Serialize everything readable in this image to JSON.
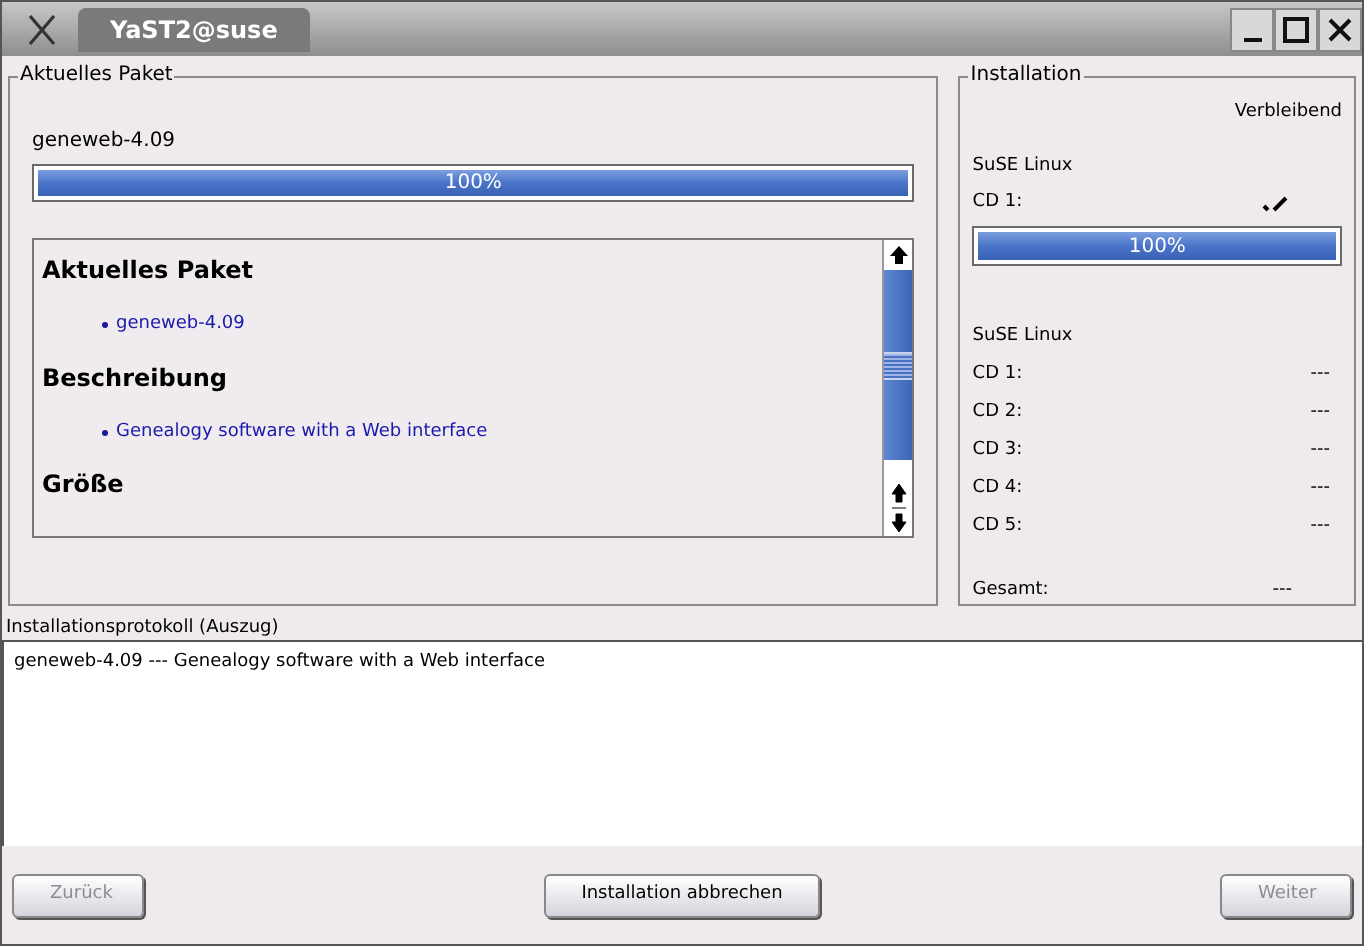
{
  "window": {
    "title": "YaST2@suse"
  },
  "current_package": {
    "title": "Aktuelles Paket",
    "name": "geneweb-4.09",
    "progress": {
      "level": 1,
      "reading": "100%"
    },
    "details": [
      {
        "heading": "Aktuelles Paket",
        "items": [
          "geneweb-4.09"
        ]
      },
      {
        "heading": "Beschreibung",
        "items": [
          "Genealogy software with a Web interface"
        ]
      },
      {
        "heading": "Größe"
      }
    ]
  },
  "installation": {
    "title": "Installation",
    "remaining_label": "Verbleibend",
    "current_media": {
      "product": "SuSE Linux",
      "label": "CD 1:",
      "done": true,
      "progress": {
        "level": 1,
        "reading": "100%"
      }
    },
    "media_product": "SuSE Linux",
    "media": [
      {
        "label": "CD 1:",
        "remaining": "---"
      },
      {
        "label": "CD 2:",
        "remaining": "---"
      },
      {
        "label": "CD 3:",
        "remaining": "---"
      },
      {
        "label": "CD 4:",
        "remaining": "---"
      },
      {
        "label": "CD 5:",
        "remaining": "---"
      }
    ],
    "total": {
      "label": "Gesamt:",
      "remaining": "---"
    }
  },
  "log": {
    "label": "Installationsprotokoll (Auszug)",
    "lines": [
      "geneweb-4.09 --- Genealogy software with a Web interface"
    ]
  },
  "buttons": [
    {
      "label": "Zurück",
      "disabled": true
    },
    {
      "label": "Installation abbrechen",
      "disabled": false
    },
    {
      "label": "Weiter",
      "disabled": true
    }
  ]
}
